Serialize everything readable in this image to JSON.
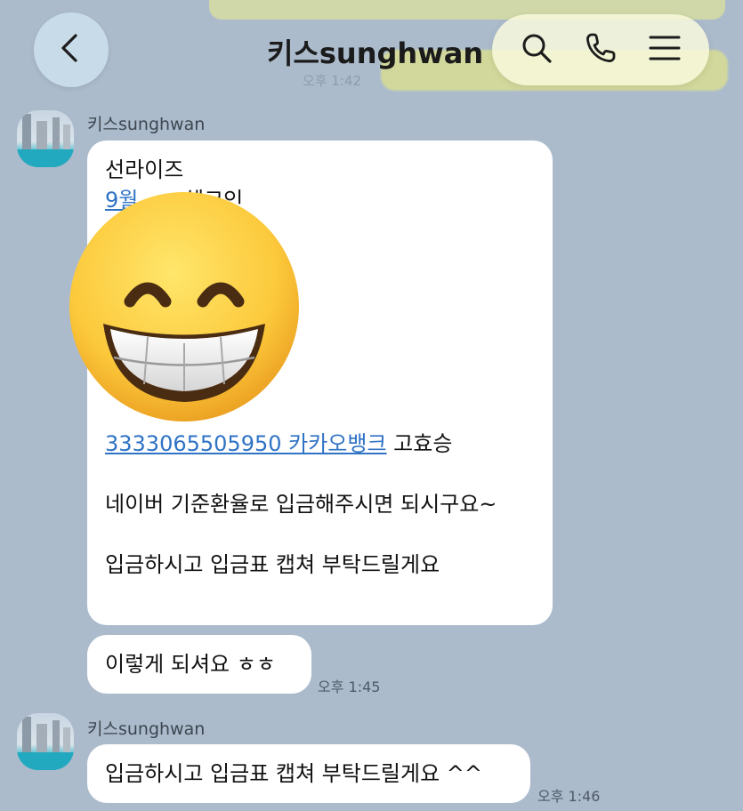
{
  "header": {
    "title": "키스sunghwan"
  },
  "background": {
    "previous_time": "오후 1:42"
  },
  "messages": {
    "first": {
      "sender": "키스sunghwan",
      "line1": "선라이즈",
      "line2_partial": "9월",
      "line2_rest": "체크인",
      "account_link": "3333065505950 카카오뱅크",
      "account_name": " 고효승",
      "exchange": "네이버 기준환율로 입금해주시면 되시구요~",
      "request": "입금하시고 입금표 캡쳐 부탁드릴게요"
    },
    "second": {
      "text": "이렇게 되셔요 ㅎㅎ",
      "time": "오후 1:45"
    },
    "third": {
      "sender": "키스sunghwan",
      "text": "입금하시고 입금표 캡쳐 부탁드릴게요 ^^",
      "time": "오후 1:46"
    }
  },
  "overlay": {
    "emoji": "grinning-face-with-smiling-eyes"
  },
  "colors": {
    "background": "#abbbcc",
    "bubble": "#ffffff",
    "link": "#2f73c5",
    "sent_bubble": "#f2f074"
  }
}
